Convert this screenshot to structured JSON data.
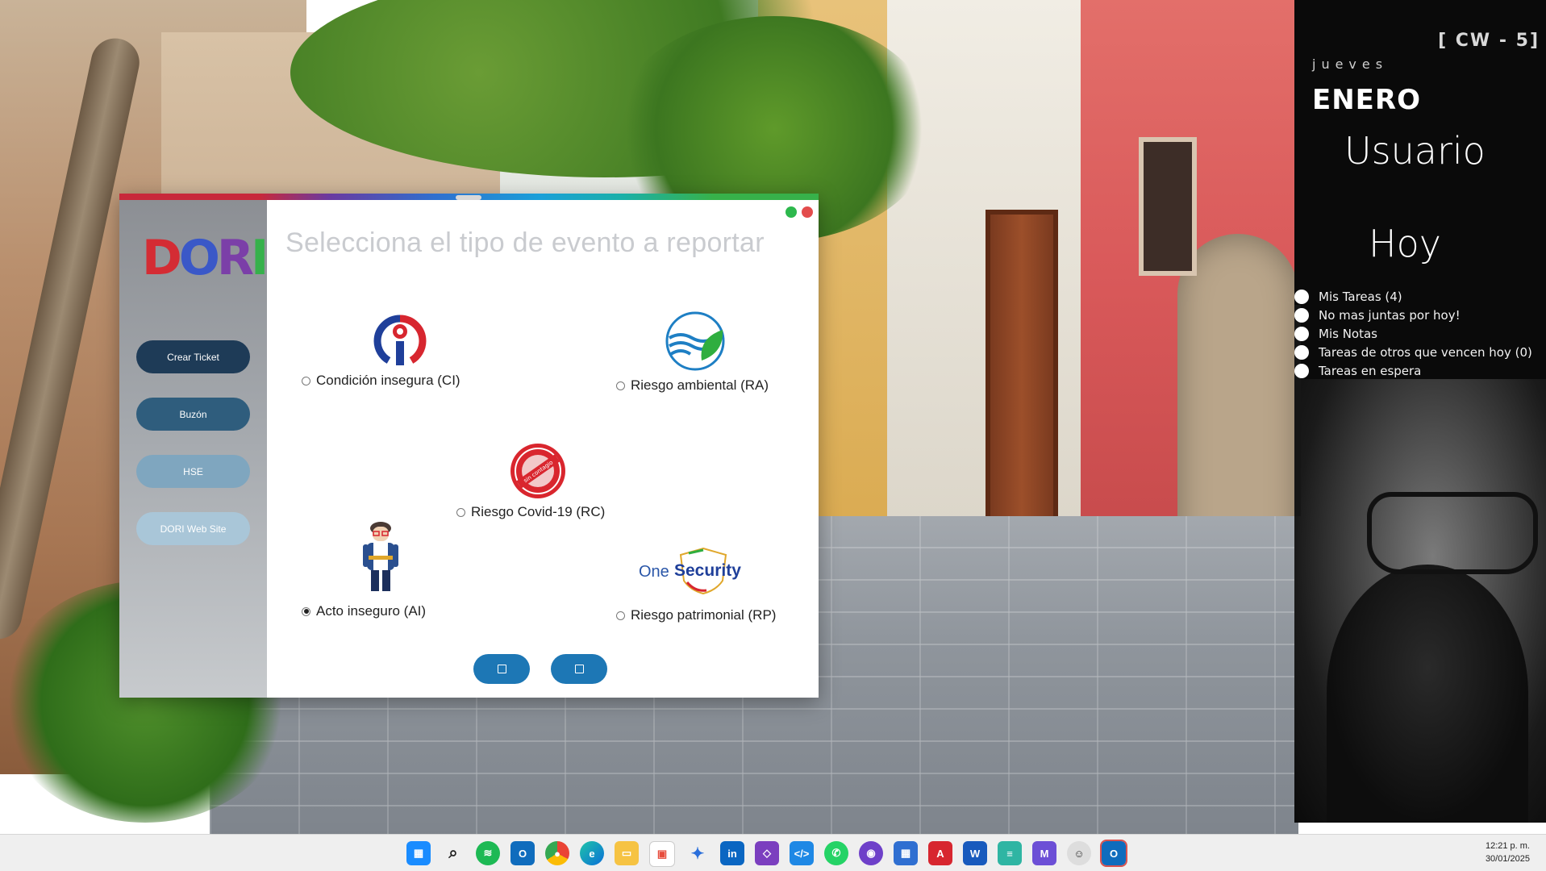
{
  "colors": {
    "nav_dark": "#1e3b57",
    "primary_button": "#1d77b5",
    "panel_bg": "#0a0a0a",
    "win_green": "#2db84d",
    "win_red": "#e34c4c"
  },
  "side_panel": {
    "week": "[ CW - 5]",
    "day": "jueves",
    "month": "ENERO",
    "user": "Usuario",
    "today": "Hoy",
    "items": [
      {
        "label": "Mis Tareas (4)"
      },
      {
        "label": "No mas juntas por hoy!"
      },
      {
        "label": "Mis Notas"
      },
      {
        "label": "Tareas de otros que vencen hoy (0)"
      },
      {
        "label": "Tareas en espera"
      }
    ]
  },
  "app": {
    "logo": [
      "D",
      "O",
      "R",
      "I"
    ],
    "nav": [
      {
        "label": "Crear Ticket"
      },
      {
        "label": "Buzón"
      },
      {
        "label": "HSE"
      },
      {
        "label": "DORI Web Site"
      }
    ],
    "title": "Selecciona el tipo de evento a reportar",
    "options": [
      {
        "label": "Condición insegura (CI)",
        "selected": false,
        "icon": "safety-person-icon"
      },
      {
        "label": "Riesgo ambiental (RA)",
        "selected": false,
        "icon": "leaf-wave-icon"
      },
      {
        "label": "Riesgo Covid-19 (RC)",
        "selected": false,
        "icon": "covid-stamp-icon"
      },
      {
        "label": "Acto inseguro (AI)",
        "selected": true,
        "icon": "worker-icon"
      },
      {
        "label": "Riesgo patrimonial (RP)",
        "selected": false,
        "icon": "onesecurity-logo"
      }
    ],
    "brand_onesecurity": {
      "one": "One",
      "security": "Security"
    },
    "buttons": {
      "back": "",
      "next": ""
    }
  },
  "taskbar": {
    "icons": [
      "windows-start-icon",
      "search-icon",
      "spotify-icon",
      "outlook-icon",
      "chrome-icon",
      "edge-icon",
      "file-explorer-icon",
      "store-icon",
      "copilot-icon",
      "linkedin-icon",
      "visual-studio-icon",
      "vscode-icon",
      "whatsapp-icon",
      "github-icon",
      "calculator-icon",
      "acrobat-icon",
      "word-icon",
      "notepad-icon",
      "mail-icon",
      "avatar-app-icon",
      "outlook-active-icon"
    ],
    "time": "12:21 p. m.",
    "date": "30/01/2025"
  }
}
